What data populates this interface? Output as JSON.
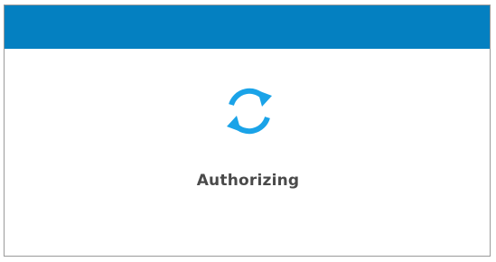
{
  "dialog": {
    "status_text": "Authorizing",
    "spinner_icon": "refresh-sync-icon"
  },
  "colors": {
    "header": "#0480c1",
    "spinner": "#1aa3e8",
    "text": "#4a4a4a"
  }
}
